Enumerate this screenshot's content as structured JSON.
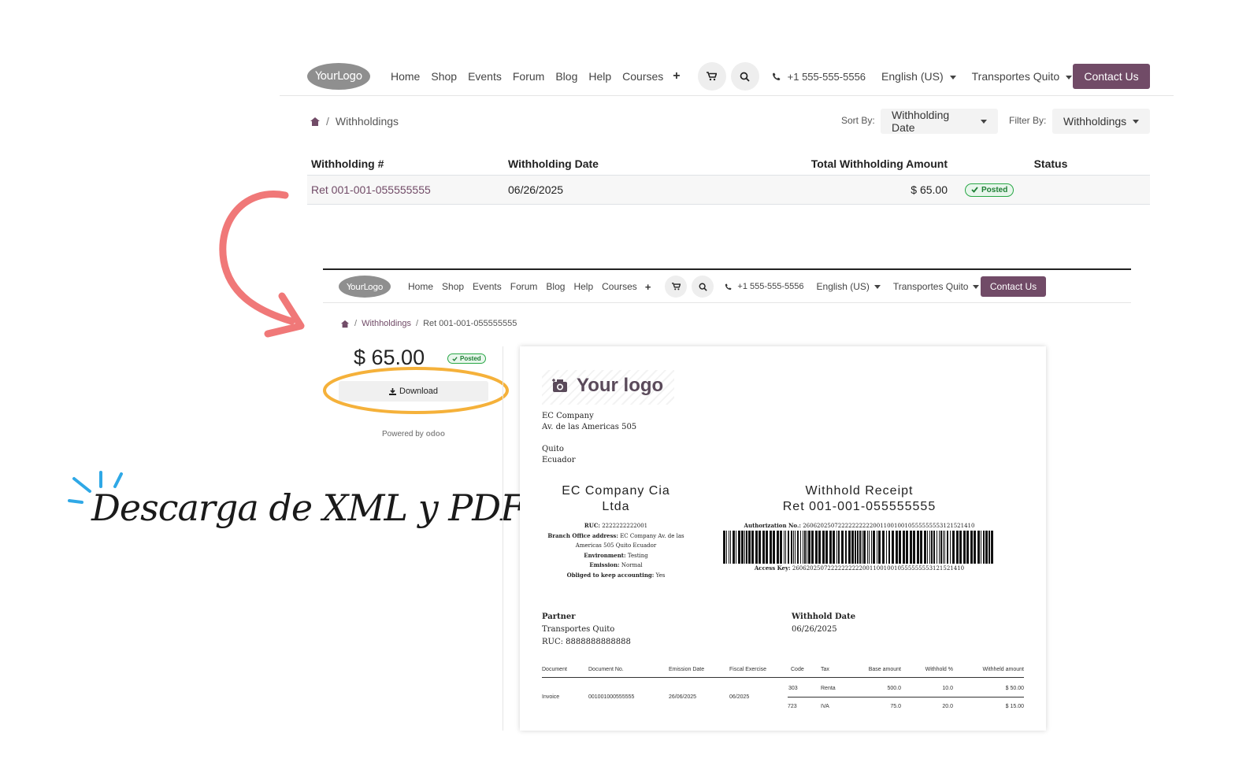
{
  "site": {
    "logo_text": "YourLogo",
    "nav_links": [
      "Home",
      "Shop",
      "Events",
      "Forum",
      "Blog",
      "Help",
      "Courses"
    ],
    "phone": "+1 555-555-5556",
    "language": "English (US)",
    "company": "Transportes Quito",
    "contact_label": "Contact Us"
  },
  "list_page": {
    "breadcrumb": "Withholdings",
    "sort_label": "Sort By:",
    "sort_value": "Withholding Date",
    "filter_label": "Filter By:",
    "filter_value": "Withholdings",
    "columns": [
      "Withholding #",
      "Withholding Date",
      "Total Withholding Amount",
      "Status"
    ],
    "row": {
      "number": "Ret 001-001-055555555",
      "date": "06/26/2025",
      "amount": "$ 65.00",
      "status": "Posted"
    }
  },
  "headline": "Descarga de XML y PDF",
  "detail_page": {
    "phone": "+1 555-555-5556",
    "breadcrumb_parent": "Withholdings",
    "breadcrumb_current": "Ret 001-001-055555555",
    "amount": "$ 65.00",
    "status": "Posted",
    "download_label": "Download",
    "powered_by": "Powered by",
    "powered_brand": "odoo"
  },
  "document": {
    "logo_text": "Your logo",
    "company_lines": [
      "EC Company",
      "Av. de las Americas 505",
      "",
      "Quito",
      "Ecuador"
    ],
    "company_name_1": "EC Company Cia",
    "company_name_2": "Ltda",
    "ruc_label": "RUC:",
    "ruc": "2222222222001",
    "branch_label": "Branch Office address:",
    "branch_1": "EC Company Av. de las",
    "branch_2": "Americas 505 Quito Ecuador",
    "environment_label": "Environment:",
    "environment": "Testing",
    "emission_label": "Emission:",
    "emission": "Normal",
    "obliged_label": "Obliged to keep accounting:",
    "obliged": "Yes",
    "receipt_title": "Withhold Receipt",
    "receipt_number": "Ret 001-001-055555555",
    "auth_label": "Authorization No.:",
    "auth_no": "2606202507222222222200110010010555555553121521410",
    "access_label": "Access Key:",
    "access_key": "2606202507222222222200110010010555555553121521410",
    "partner_label": "Partner",
    "partner_name": "Transportes Quito",
    "partner_ruc": "RUC: 8888888888888",
    "withhold_date_label": "Withhold Date",
    "withhold_date": "06/26/2025",
    "table_headers": [
      "Document",
      "Document No.",
      "Emission Date",
      "Fiscal Exercise",
      "Code",
      "Tax",
      "Base amount",
      "Withhold %",
      "Withheld amount"
    ],
    "doc_row": {
      "document": "Invoice",
      "number": "001001000555555",
      "emission": "26/06/2025",
      "fiscal": "06/2025"
    },
    "lines": [
      {
        "code": "303",
        "tax": "Renta",
        "base": "500.0",
        "pct": "10.0",
        "amount": "$ 50.00"
      },
      {
        "code": "723",
        "tax": "IVA",
        "base": "75.0",
        "pct": "20.0",
        "amount": "$ 15.00"
      }
    ]
  },
  "colors": {
    "brand": "#714b67",
    "arrow": "#f07878",
    "highlight_ring": "#f5b13a",
    "sparks": "#2fa8e6",
    "posted_green": "#28a745"
  }
}
